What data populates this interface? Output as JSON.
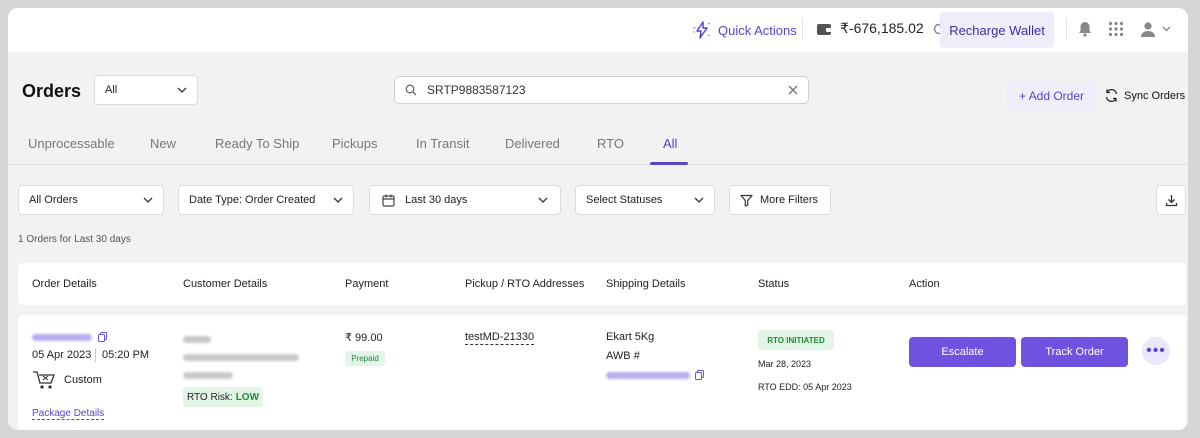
{
  "topbar": {
    "quick_actions_label": "Quick Actions",
    "wallet_balance": "₹-676,185.02",
    "recharge_label": "Recharge Wallet"
  },
  "header": {
    "title": "Orders",
    "order_scope_selected": "All",
    "search_value": "SRTP9883587123",
    "add_order_label": "+ Add Order",
    "sync_orders_label": "Sync Orders"
  },
  "tabs": [
    {
      "label": "Unprocessable",
      "active": false
    },
    {
      "label": "New",
      "active": false
    },
    {
      "label": "Ready To Ship",
      "active": false
    },
    {
      "label": "Pickups",
      "active": false
    },
    {
      "label": "In Transit",
      "active": false
    },
    {
      "label": "Delivered",
      "active": false
    },
    {
      "label": "RTO",
      "active": false
    },
    {
      "label": "All",
      "active": true
    }
  ],
  "filters": {
    "orders_type": "All Orders",
    "date_type": "Date Type: Order Created",
    "date_range": "Last 30 days",
    "statuses": "Select Statuses",
    "more_filters_label": "More Filters"
  },
  "results_summary": "1 Orders for Last 30 days",
  "table": {
    "columns": [
      "Order Details",
      "Customer Details",
      "Payment",
      "Pickup / RTO Addresses",
      "Shipping Details",
      "Status",
      "Action"
    ],
    "rows": [
      {
        "order_date": "05 Apr 2023",
        "order_time": "05:20 PM",
        "channel": "Custom",
        "package_details_link": "Package Details",
        "rto_risk_label": "RTO Risk:",
        "rto_risk_value": "LOW",
        "amount": "₹ 99.00",
        "payment_mode": "Prepaid",
        "pickup_address": "testMD-21330",
        "courier": "Ekart 5Kg",
        "awb_label": "AWB #",
        "status_badge": "RTO INITIATED",
        "status_date": "Mar 28, 2023",
        "rto_edd": "RTO EDD: 05 Apr 2023",
        "escalate_label": "Escalate",
        "track_label": "Track Order"
      }
    ]
  },
  "colors": {
    "accent": "#5a45c9",
    "button": "#6f52e0",
    "success_bg": "#e3f5e6",
    "success_text": "#1e8c3a"
  }
}
